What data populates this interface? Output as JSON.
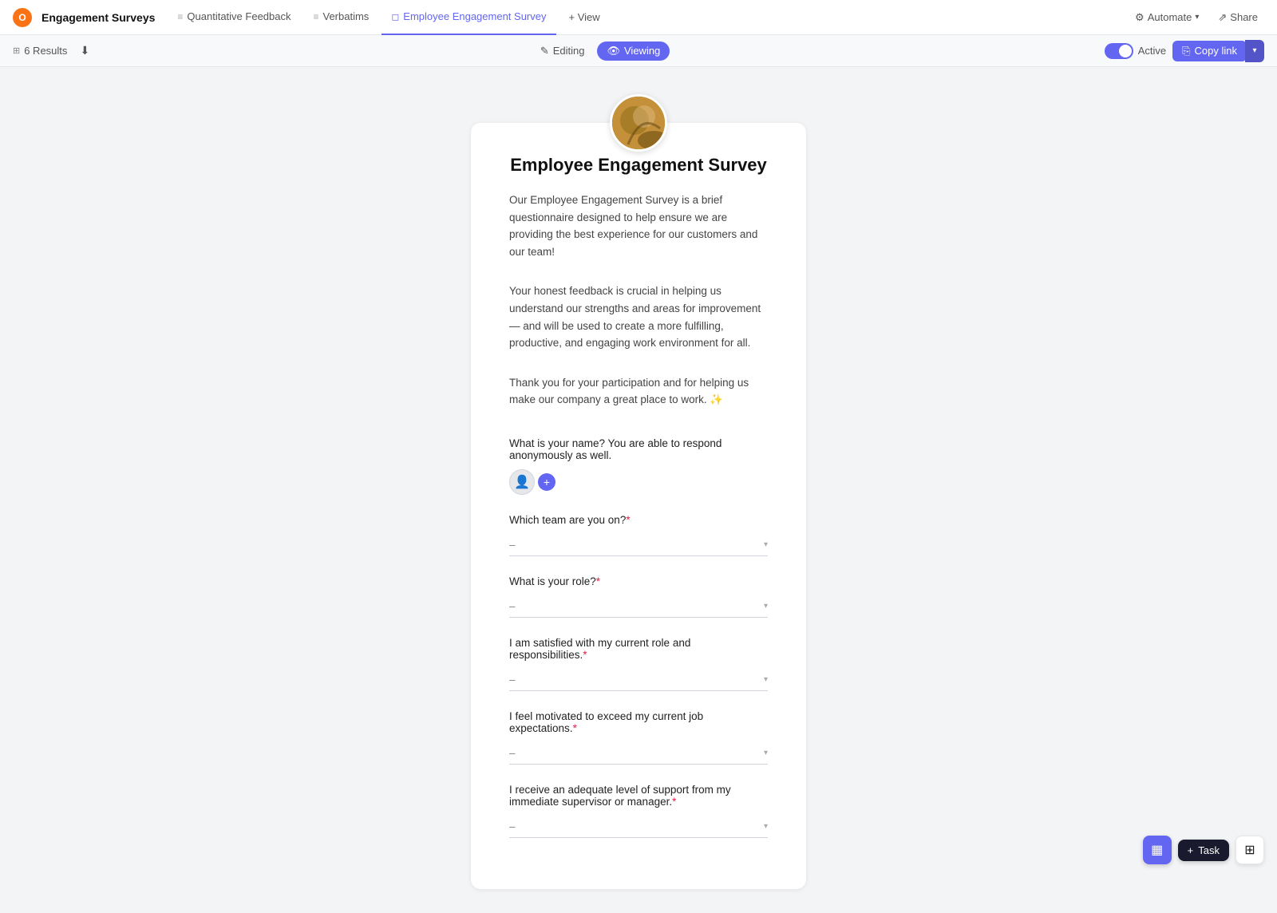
{
  "app": {
    "logo": "O",
    "title": "Engagement Surveys"
  },
  "topnav": {
    "tabs": [
      {
        "id": "quantitative",
        "label": "Quantitative Feedback",
        "icon": "≡",
        "active": false
      },
      {
        "id": "verbatims",
        "label": "Verbatims",
        "icon": "≡",
        "active": false
      },
      {
        "id": "employee-survey",
        "label": "Employee Engagement Survey",
        "icon": "◻",
        "active": true
      }
    ],
    "view_label": "+ View",
    "automate_label": "Automate",
    "share_label": "Share"
  },
  "subtoolbar": {
    "results_label": "6 Results",
    "editing_label": "Editing",
    "viewing_label": "Viewing",
    "active_label": "Active",
    "copy_link_label": "Copy link"
  },
  "survey": {
    "title": "Employee Engagement Survey",
    "description_1": "Our Employee Engagement Survey is a brief questionnaire designed to help ensure we are providing the best experience for our customers and our team!",
    "description_2": "Your honest feedback is crucial in helping us understand our strengths and areas for improvement — and will be used to create a more fulfilling, productive, and engaging work environment for all.",
    "description_3": "Thank you for your participation and for helping us make our company a great place to work. ✨",
    "questions": [
      {
        "id": "q1",
        "label": "What is your name? You are able to respond anonymously as well.",
        "type": "people",
        "required": false
      },
      {
        "id": "q2",
        "label": "Which team are you on?",
        "type": "dropdown",
        "required": true,
        "placeholder": "–"
      },
      {
        "id": "q3",
        "label": "What is your role?",
        "type": "dropdown",
        "required": true,
        "placeholder": "–"
      },
      {
        "id": "q4",
        "label": "I am satisfied with my current role and responsibilities.",
        "type": "dropdown",
        "required": true,
        "placeholder": "–"
      },
      {
        "id": "q5",
        "label": "I feel motivated to exceed my current job expectations.",
        "type": "dropdown",
        "required": true,
        "placeholder": "–"
      },
      {
        "id": "q6",
        "label": "I receive an adequate level of support from my immediate supervisor or manager.",
        "type": "dropdown",
        "required": true,
        "placeholder": "–"
      }
    ]
  },
  "bottom_actions": {
    "task_label": "Task",
    "grid_icon": "⊞",
    "table_icon": "▦"
  }
}
